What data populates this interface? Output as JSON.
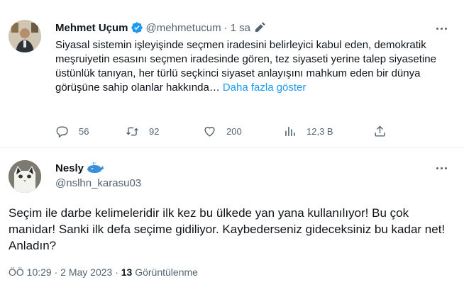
{
  "tweet1": {
    "name": "Mehmet Uçum",
    "handle": "@mehmetucum",
    "separator": "·",
    "time": "1 sa",
    "text": "Siyasal sistemin işleyişinde seçmen iradesini belirleyici kabul eden, demokratik meşruiyetin esasını seçmen iradesinde gören, tez siyaseti yerine talep siyasetine üstünlük tanıyan, her türlü seçkinci siyaset anlayışını mahkum eden bir dünya görüşüne sahip olanlar hakkında…",
    "show_more": "Daha fazla göster",
    "replies": "56",
    "retweets": "92",
    "likes": "200",
    "views": "12,3 B"
  },
  "tweet2": {
    "name": "Nesly",
    "handle": "@nslhn_karasu03",
    "text": "Seçim ile darbe kelimeleridir ilk kez bu ülkede yan yana kullanılıyor! Bu çok manidar!  Sanki ilk defa seçime gidiliyor. Kaybederseniz gideceksiniz bu kadar net! Anladın?",
    "timestamp": "ÖÖ 10:29 · 2 May 2023 · ",
    "views_count": "13",
    "views_label": " Görüntülenme"
  },
  "colors": {
    "accent": "#1d9bf0",
    "secondary_text": "#536471",
    "primary_text": "#0f1419",
    "divider": "#eff3f4"
  },
  "icons": [
    "verified-badge-icon",
    "pen-icon",
    "more-icon",
    "reply-icon",
    "retweet-icon",
    "like-icon",
    "views-icon",
    "share-icon",
    "whale-icon"
  ]
}
